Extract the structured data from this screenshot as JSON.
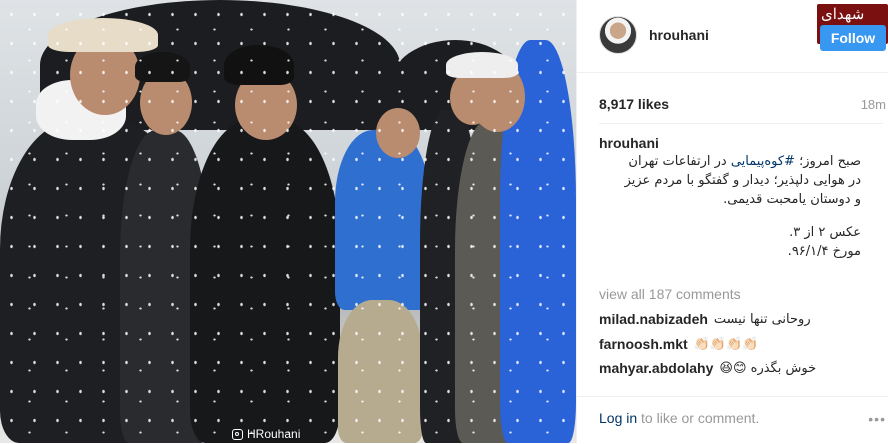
{
  "photo": {
    "watermark": "HRouhani"
  },
  "header": {
    "username": "hrouhani",
    "follow_label": "Follow",
    "site_logo": "شهدای ایران"
  },
  "stats": {
    "likes": "8,917 likes",
    "time": "18m"
  },
  "caption": {
    "username": "hrouhani",
    "line1_pre": "صبح امروز؛ ",
    "hashtag": "#کوه‌پیمایی",
    "line1_post": " در ارتفاعات تهران",
    "line2": "در هوایی دلپذیر؛ دیدار و گفتگو با مردم عزیز",
    "line3": "و دوستان یامحبت قدیمی.",
    "line4": "عکس ۲ از ۳.",
    "line5": "مورخ ۹۶/۱/۴."
  },
  "comments": {
    "view_all": "view all 187 comments",
    "items": [
      {
        "user": "milad.nabizadeh",
        "text": "روحانی تنها نیست"
      },
      {
        "user": "farnoosh.mkt",
        "text": "👏🏻👏🏻👏🏻👏🏻"
      },
      {
        "user": "mahyar.abdolahy",
        "text": "😆😊 خوش بگذره"
      }
    ]
  },
  "footer": {
    "login_link": "Log in",
    "login_text": " to like or comment.",
    "more_icon": "•••"
  },
  "colors": {
    "follow": "#3897f0",
    "link": "#003569",
    "muted": "#999999"
  }
}
